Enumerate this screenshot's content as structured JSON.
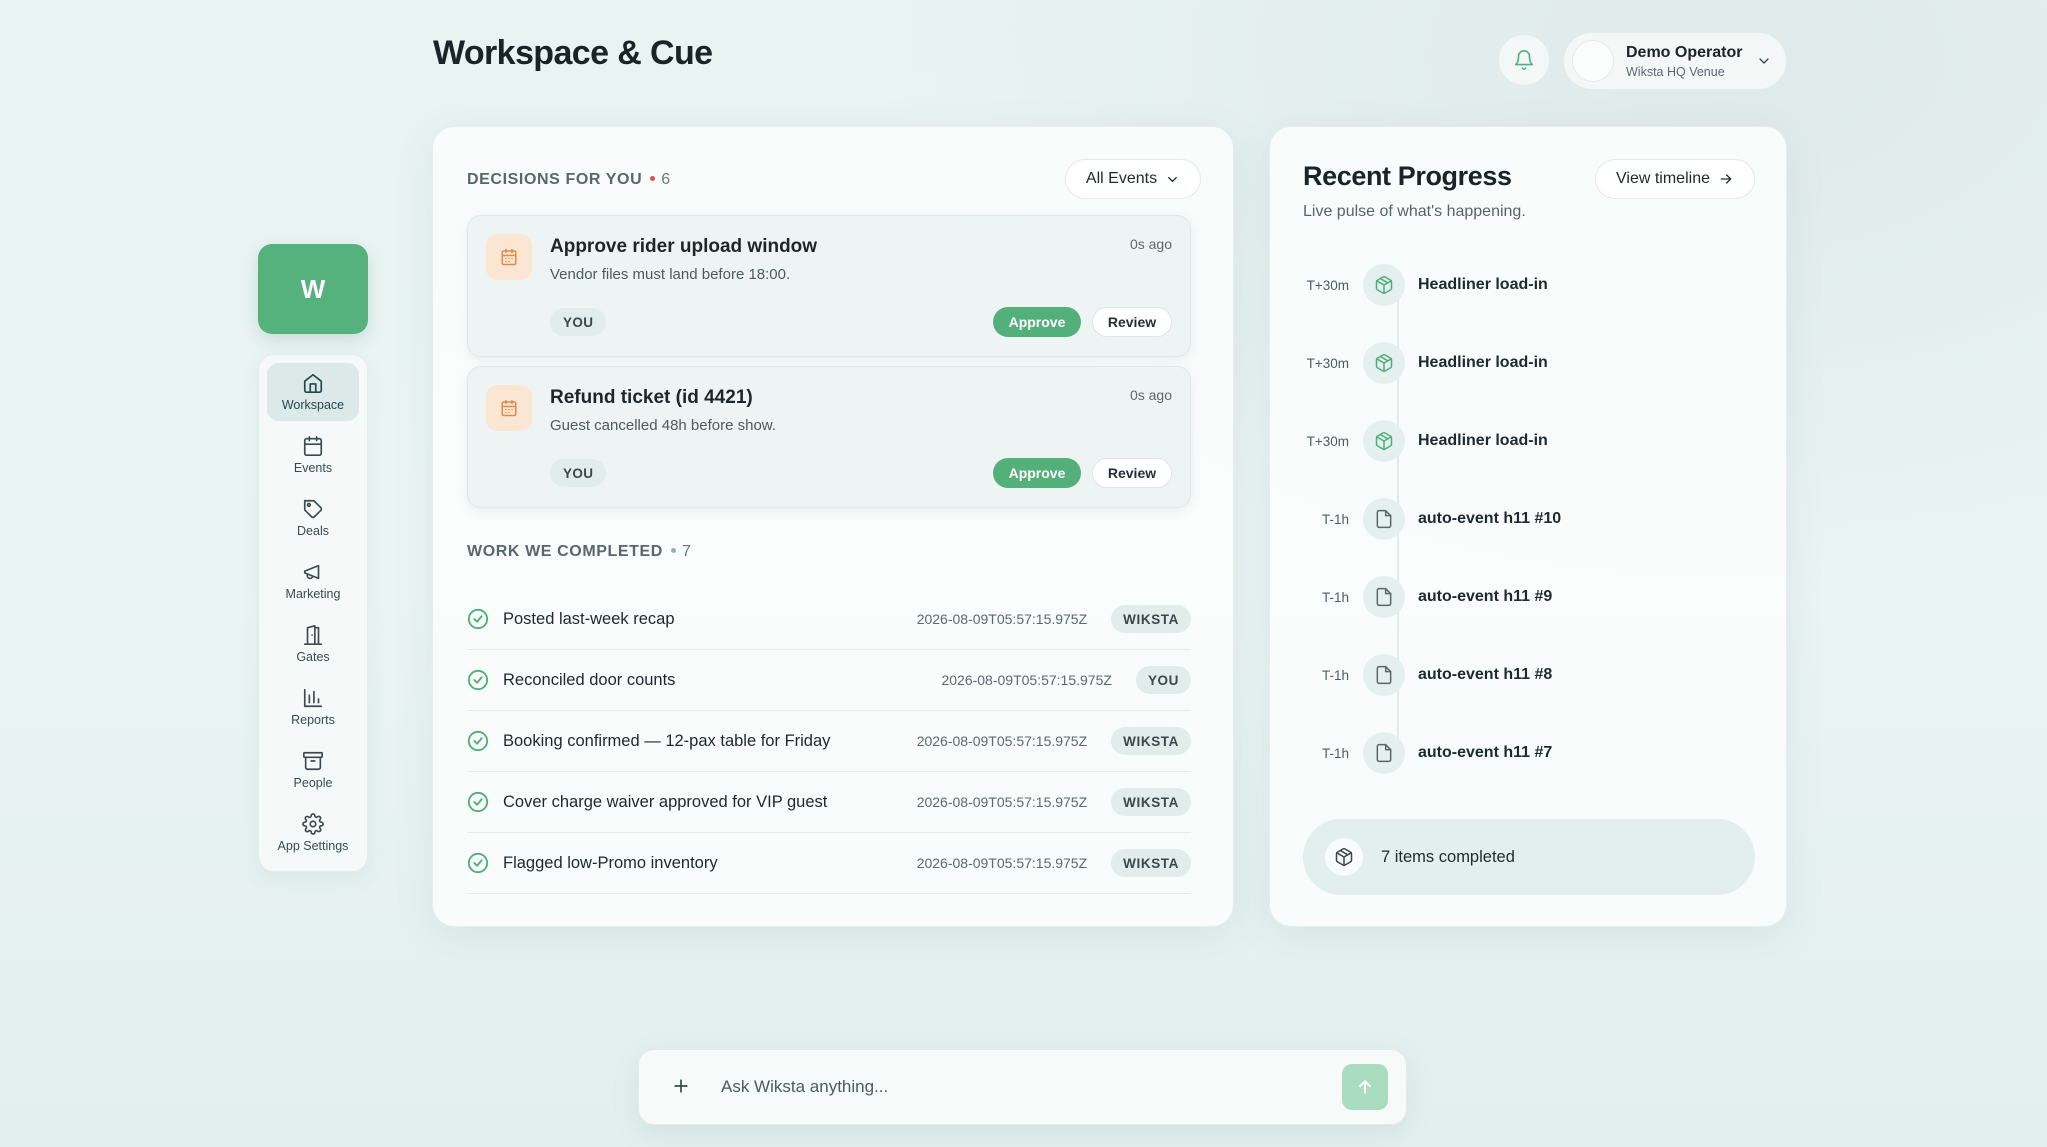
{
  "header": {
    "title": "Workspace & Cue",
    "user": {
      "name": "Demo Operator",
      "venue": "Wiksta HQ Venue"
    }
  },
  "brand": {
    "letter": "W",
    "color": "#55b27d"
  },
  "sidebar": {
    "items": [
      {
        "label": "Workspace",
        "icon": "home-icon",
        "active": true
      },
      {
        "label": "Events",
        "icon": "calendar-icon"
      },
      {
        "label": "Deals",
        "icon": "tag-icon"
      },
      {
        "label": "Marketing",
        "icon": "megaphone-icon"
      },
      {
        "label": "Gates",
        "icon": "gate-icon"
      },
      {
        "label": "Reports",
        "icon": "bar-chart-icon"
      },
      {
        "label": "People",
        "icon": "archive-icon"
      },
      {
        "label": "App Settings",
        "icon": "gear-icon"
      }
    ]
  },
  "decisions": {
    "label": "DECISIONS FOR YOU",
    "count": "6",
    "filter": "All Events",
    "items": [
      {
        "title": "Approve rider upload window",
        "subtitle": "Vendor files must land before 18:00.",
        "time": "0s ago",
        "owner": "YOU",
        "approve": "Approve",
        "review": "Review"
      },
      {
        "title": "Refund ticket (id 4421)",
        "subtitle": "Guest cancelled 48h before show.",
        "time": "0s ago",
        "owner": "YOU",
        "approve": "Approve",
        "review": "Review"
      }
    ]
  },
  "completed": {
    "label": "WORK WE COMPLETED",
    "count": "7",
    "items": [
      {
        "title": "Posted last-week recap",
        "time": "2026-08-09T05:57:15.975Z",
        "by": "WIKSTA"
      },
      {
        "title": "Reconciled door counts",
        "time": "2026-08-09T05:57:15.975Z",
        "by": "YOU"
      },
      {
        "title": "Booking confirmed — 12-pax table for Friday",
        "time": "2026-08-09T05:57:15.975Z",
        "by": "WIKSTA"
      },
      {
        "title": "Cover charge waiver approved for VIP guest",
        "time": "2026-08-09T05:57:15.975Z",
        "by": "WIKSTA"
      },
      {
        "title": "Flagged low-Promo inventory",
        "time": "2026-08-09T05:57:15.975Z",
        "by": "WIKSTA"
      }
    ]
  },
  "progress": {
    "title": "Recent Progress",
    "subtitle": "Live pulse of what's happening.",
    "timeline_button": "View timeline",
    "items": [
      {
        "offset": "T+30m",
        "label": "Headliner load-in",
        "icon": "package-icon"
      },
      {
        "offset": "T+30m",
        "label": "Headliner load-in",
        "icon": "package-icon"
      },
      {
        "offset": "T+30m",
        "label": "Headliner load-in",
        "icon": "package-icon"
      },
      {
        "offset": "T-1h",
        "label": "auto-event h11 #10",
        "icon": "file-icon"
      },
      {
        "offset": "T-1h",
        "label": "auto-event h11 #9",
        "icon": "file-icon"
      },
      {
        "offset": "T-1h",
        "label": "auto-event h11 #8",
        "icon": "file-icon"
      },
      {
        "offset": "T-1h",
        "label": "auto-event h11 #7",
        "icon": "file-icon"
      }
    ],
    "summary": "7 items completed"
  },
  "ask": {
    "placeholder": "Ask Wiksta anything..."
  },
  "colors": {
    "accent": "#53b07b",
    "decision_icon_bg": "#fbe6d3",
    "decision_icon": "#e08a4a",
    "alert_dot": "#d8553f"
  }
}
